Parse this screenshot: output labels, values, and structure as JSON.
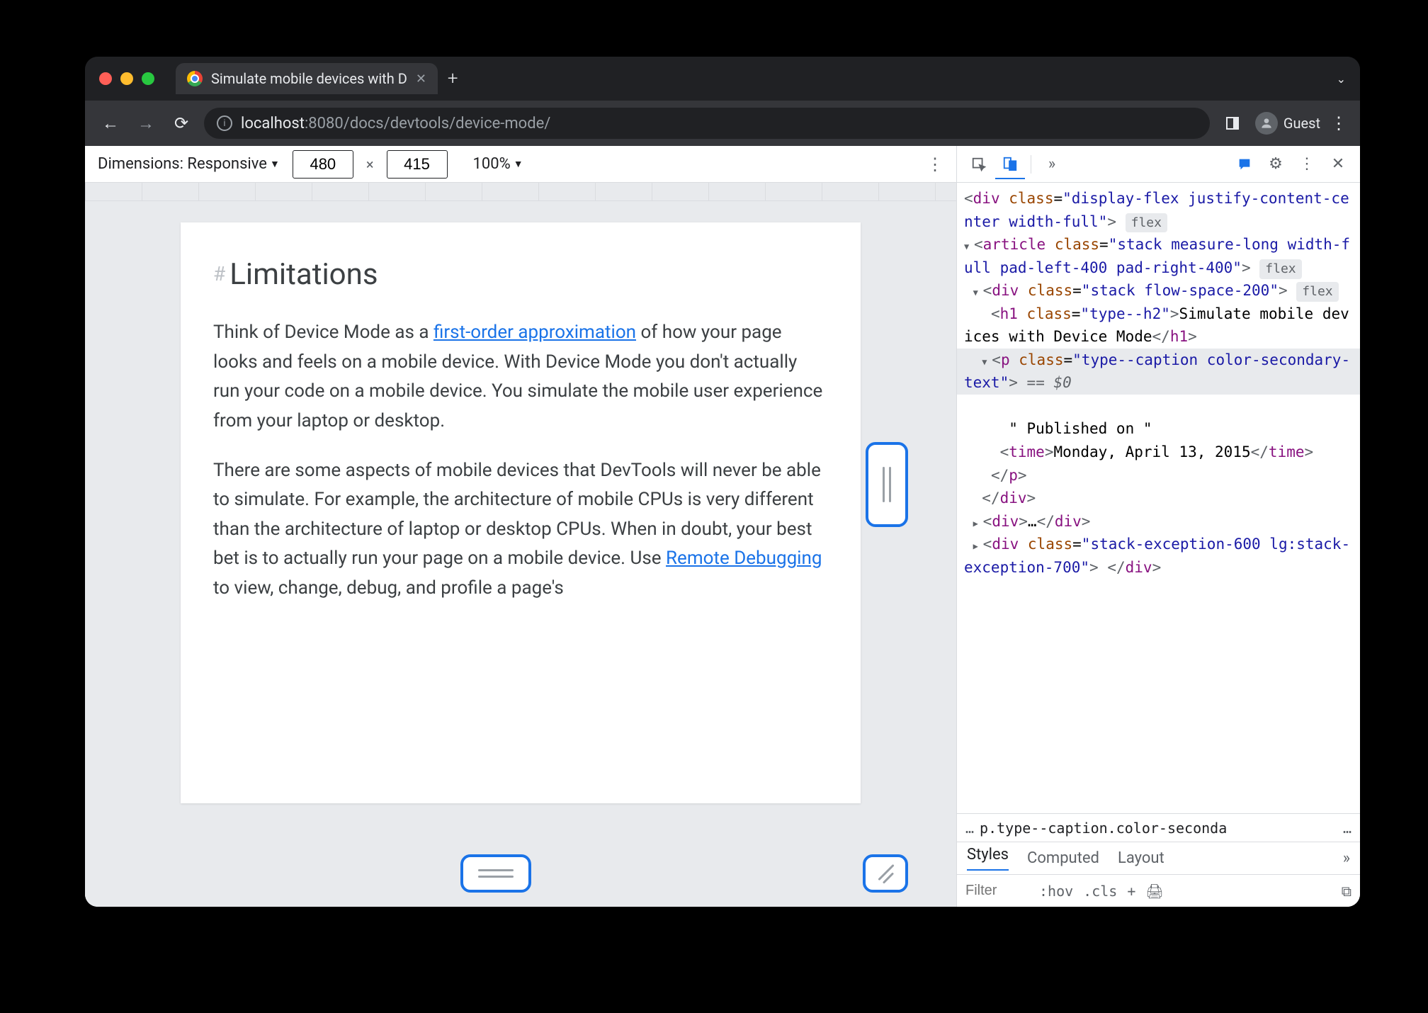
{
  "window": {
    "tab_title": "Simulate mobile devices with D",
    "url_host": "localhost",
    "url_port": ":8080",
    "url_path": "/docs/devtools/device-mode/",
    "profile": "Guest"
  },
  "device_toolbar": {
    "dimensions_label": "Dimensions: Responsive",
    "width": "480",
    "height": "415",
    "zoom": "100%"
  },
  "page": {
    "heading": "Limitations",
    "p1_pre": "Think of Device Mode as a ",
    "p1_link": "first-order approximation",
    "p1_post": " of how your page looks and feels on a mobile device. With Device Mode you don't actually run your code on a mobile device. You simulate the mobile user experience from your laptop or desktop.",
    "p2_pre": "There are some aspects of mobile devices that DevTools will never be able to simulate. For example, the architecture of mobile CPUs is very different than the architecture of laptop or desktop CPUs. When in doubt, your best bet is to actually run your page on a mobile device. Use ",
    "p2_link": "Remote Debugging",
    "p2_post": " to view, change, debug, and profile a page's"
  },
  "elements": {
    "div_class": "display-flex justify-content-center width-full",
    "article_class": "stack measure-long width-full pad-left-400 pad-right-400",
    "div2_class": "stack flow-space-200",
    "h1_class": "type--h2",
    "h1_text": "Simulate mobile devices with Device Mode",
    "p_class": "type--caption color-secondary-text",
    "p_after": "== $0",
    "text_node": "\" Published on \"",
    "time_text": "Monday, April 13, 2015",
    "div3": "…",
    "div4_class": "stack-exception-600 lg:stack-exception-700",
    "badge_flex": "flex"
  },
  "crumb": {
    "left": "…",
    "path": "p.type--caption.color-seconda",
    "right": "…"
  },
  "styles": {
    "tabs": [
      "Styles",
      "Computed",
      "Layout"
    ],
    "filter_ph": "Filter",
    "hov": ":hov",
    "cls": ".cls"
  }
}
